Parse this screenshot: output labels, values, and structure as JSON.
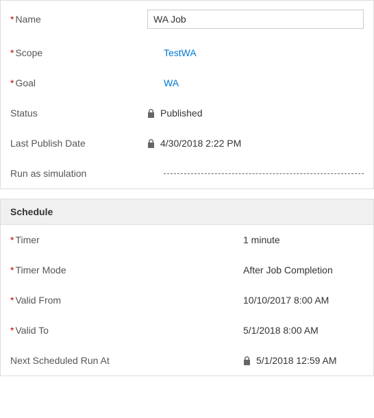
{
  "top": {
    "fields": {
      "name": {
        "label": "Name",
        "value": "WA Job",
        "required": true
      },
      "scope": {
        "label": "Scope",
        "value": "TestWA",
        "required": true
      },
      "goal": {
        "label": "Goal",
        "value": "WA",
        "required": true
      },
      "status": {
        "label": "Status",
        "value": "Published",
        "required": false
      },
      "lastPublish": {
        "label": "Last Publish Date",
        "value": "4/30/2018  2:22 PM",
        "required": false
      },
      "runAsSim": {
        "label": "Run as simulation",
        "required": false
      }
    }
  },
  "schedule": {
    "header": "Schedule",
    "fields": {
      "timer": {
        "label": "Timer",
        "value": "1 minute",
        "required": true
      },
      "timerMode": {
        "label": "Timer Mode",
        "value": "After Job Completion",
        "required": true
      },
      "validFrom": {
        "label": "Valid From",
        "value": "10/10/2017  8:00 AM",
        "required": true
      },
      "validTo": {
        "label": "Valid To",
        "value": "5/1/2018  8:00 AM",
        "required": true
      },
      "nextRun": {
        "label": "Next Scheduled Run At",
        "value": "5/1/2018  12:59 AM",
        "required": false
      }
    }
  }
}
